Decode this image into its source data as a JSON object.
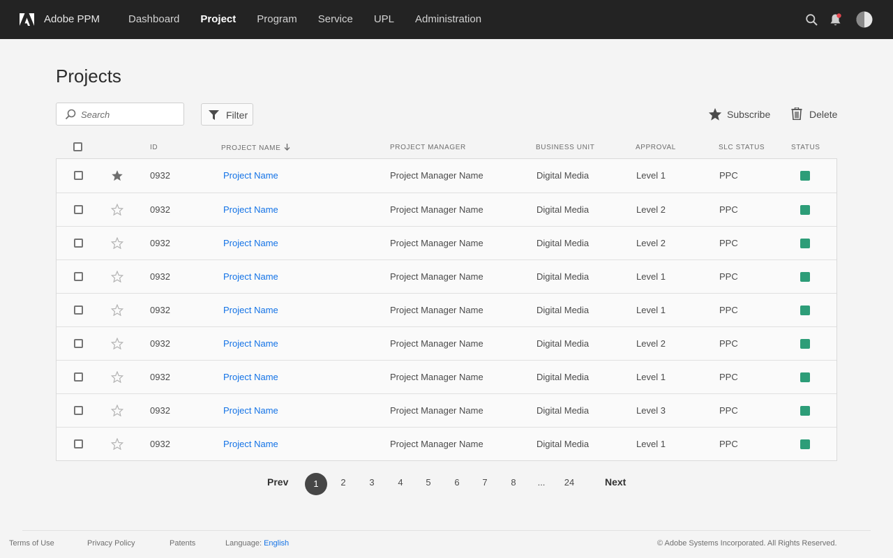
{
  "header": {
    "brand": "Adobe PPM",
    "nav": [
      {
        "label": "Dashboard",
        "active": false
      },
      {
        "label": "Project",
        "active": true
      },
      {
        "label": "Program",
        "active": false
      },
      {
        "label": "Service",
        "active": false
      },
      {
        "label": "UPL",
        "active": false
      },
      {
        "label": "Administration",
        "active": false
      }
    ],
    "icons": [
      "adobe-logo-icon",
      "search-icon",
      "bell-icon",
      "avatar"
    ],
    "notification_badge_color": "#e34850"
  },
  "page": {
    "title": "Projects"
  },
  "toolbar": {
    "search_placeholder": "Search",
    "filter_label": "Filter",
    "subscribe_label": "Subscribe",
    "delete_label": "Delete"
  },
  "table": {
    "columns": {
      "id": "ID",
      "project_name": "PROJECT NAME",
      "project_manager": "PROJECT MANAGER",
      "business_unit": "BUSINESS UNIT",
      "approval": "APPROVAL",
      "slc_status": "SLC STATUS",
      "status": "STATUS"
    },
    "sort_column": "project_name",
    "sort_direction": "descending",
    "status_color": "#2d9d78",
    "link_color": "#1473e6",
    "rows": [
      {
        "starred": true,
        "id": "0932",
        "project_name": "Project Name",
        "project_manager": "Project Manager Name",
        "business_unit": "Digital Media",
        "approval": "Level 1",
        "slc_status": "PPC"
      },
      {
        "starred": false,
        "id": "0932",
        "project_name": "Project Name",
        "project_manager": "Project Manager Name",
        "business_unit": "Digital Media",
        "approval": "Level 2",
        "slc_status": "PPC"
      },
      {
        "starred": false,
        "id": "0932",
        "project_name": "Project Name",
        "project_manager": "Project Manager Name",
        "business_unit": "Digital Media",
        "approval": "Level 2",
        "slc_status": "PPC"
      },
      {
        "starred": false,
        "id": "0932",
        "project_name": "Project Name",
        "project_manager": "Project Manager Name",
        "business_unit": "Digital Media",
        "approval": "Level 1",
        "slc_status": "PPC"
      },
      {
        "starred": false,
        "id": "0932",
        "project_name": "Project Name",
        "project_manager": "Project Manager Name",
        "business_unit": "Digital Media",
        "approval": "Level 1",
        "slc_status": "PPC"
      },
      {
        "starred": false,
        "id": "0932",
        "project_name": "Project Name",
        "project_manager": "Project Manager Name",
        "business_unit": "Digital Media",
        "approval": "Level 2",
        "slc_status": "PPC"
      },
      {
        "starred": false,
        "id": "0932",
        "project_name": "Project Name",
        "project_manager": "Project Manager Name",
        "business_unit": "Digital Media",
        "approval": "Level 1",
        "slc_status": "PPC"
      },
      {
        "starred": false,
        "id": "0932",
        "project_name": "Project Name",
        "project_manager": "Project Manager Name",
        "business_unit": "Digital Media",
        "approval": "Level 3",
        "slc_status": "PPC"
      },
      {
        "starred": false,
        "id": "0932",
        "project_name": "Project Name",
        "project_manager": "Project Manager Name",
        "business_unit": "Digital Media",
        "approval": "Level 1",
        "slc_status": "PPC"
      }
    ]
  },
  "pagination": {
    "prev_label": "Prev",
    "next_label": "Next",
    "pages": [
      "1",
      "2",
      "3",
      "4",
      "5",
      "6",
      "7",
      "8",
      "...",
      "24"
    ],
    "current": "1"
  },
  "footer": {
    "terms": "Terms of Use",
    "privacy": "Privacy Policy",
    "patents": "Patents",
    "language_label": "Language:",
    "language_value": "English",
    "copyright": "© Adobe Systems Incorporated. All Rights Reserved."
  }
}
